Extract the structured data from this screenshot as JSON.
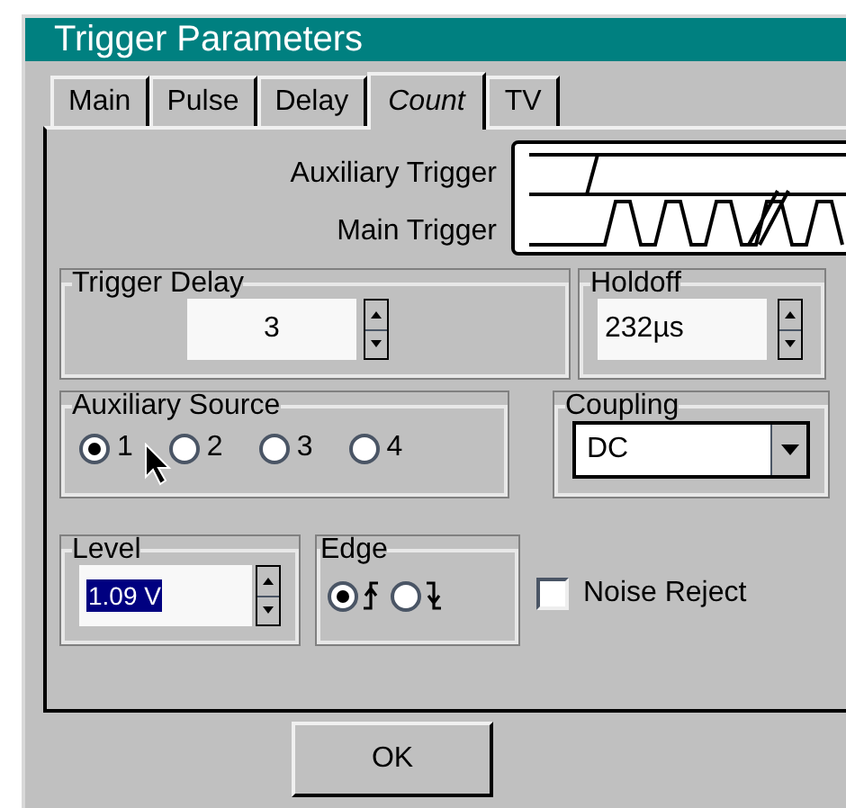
{
  "window": {
    "title": "Trigger Parameters"
  },
  "tabs": [
    {
      "label": "Main",
      "selected": false
    },
    {
      "label": "Pulse",
      "selected": false
    },
    {
      "label": "Delay",
      "selected": false
    },
    {
      "label": "Count",
      "selected": true
    },
    {
      "label": "TV",
      "selected": false
    }
  ],
  "diagram": {
    "labels": [
      "Auxiliary Trigger",
      "Main Trigger"
    ]
  },
  "trigger_delay": {
    "label": "Trigger Delay",
    "value": "3"
  },
  "holdoff": {
    "label": "Holdoff",
    "value": "232µs"
  },
  "auxiliary_source": {
    "label": "Auxiliary Source",
    "options": [
      {
        "label": "1",
        "selected": true
      },
      {
        "label": "2",
        "selected": false
      },
      {
        "label": "3",
        "selected": false
      },
      {
        "label": "4",
        "selected": false
      }
    ]
  },
  "coupling": {
    "label": "Coupling",
    "value": "DC"
  },
  "level": {
    "label": "Level",
    "value": "1.09 V",
    "highlighted": true
  },
  "edge": {
    "label": "Edge",
    "options": [
      {
        "kind": "rising",
        "selected": true
      },
      {
        "kind": "falling",
        "selected": false
      }
    ]
  },
  "noise_reject": {
    "label": "Noise Reject",
    "checked": false
  },
  "buttons": [
    "OK"
  ]
}
